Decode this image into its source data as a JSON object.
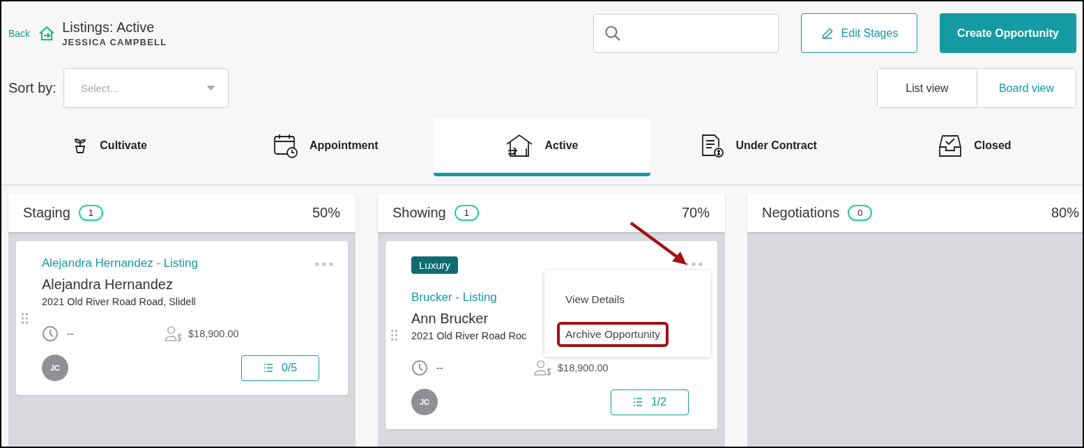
{
  "header": {
    "back_link": "Back",
    "title": "Listings: Active",
    "subtitle": "JESSICA CAMPBELL"
  },
  "buttons": [
    {
      "label": "Edit Stages",
      "kind": "outline"
    },
    {
      "label": "Create Opportunity",
      "kind": "primary"
    }
  ],
  "sort": {
    "label": "Sort by:",
    "placeholder": "Select..."
  },
  "views": [
    {
      "label": "List view",
      "selected": false
    },
    {
      "label": "Board view",
      "selected": true
    }
  ],
  "stages": [
    {
      "label": "Cultivate",
      "kind": "plant",
      "selected": false
    },
    {
      "label": "Appointment",
      "kind": "calendar",
      "selected": false
    },
    {
      "label": "Active",
      "kind": "house",
      "selected": true
    },
    {
      "label": "Under Contract",
      "kind": "document",
      "selected": false
    },
    {
      "label": "Closed",
      "kind": "inbox",
      "selected": false
    }
  ],
  "columns": [
    {
      "name": "Staging",
      "count": "1",
      "percent": "50%",
      "cards": [
        {
          "title": "Alejandra Hernandez - Listing",
          "contact": "Alejandra Hernandez",
          "address": "2021 Old River Road Road, Slidell",
          "date": "--",
          "amount": "$18,900.00",
          "owner": "JC",
          "tasks": "0/5",
          "arrow": false
        }
      ]
    },
    {
      "name": "Showing",
      "count": "1",
      "percent": "70%",
      "cards": [
        {
          "tag": "Luxury",
          "title": "Brucker - Listing",
          "contact": "Ann Brucker",
          "address": "2021 Old River Road Roc",
          "date": "--",
          "amount": "$18,900.00",
          "owner": "JC",
          "tasks": "1/2",
          "arrow": true,
          "menu": [
            {
              "label": "View Details",
              "highlighted": false
            },
            {
              "label": "Archive Opportunity",
              "highlighted": true
            }
          ]
        }
      ]
    },
    {
      "name": "Negotiations",
      "count": "0",
      "percent": "80%"
    }
  ]
}
